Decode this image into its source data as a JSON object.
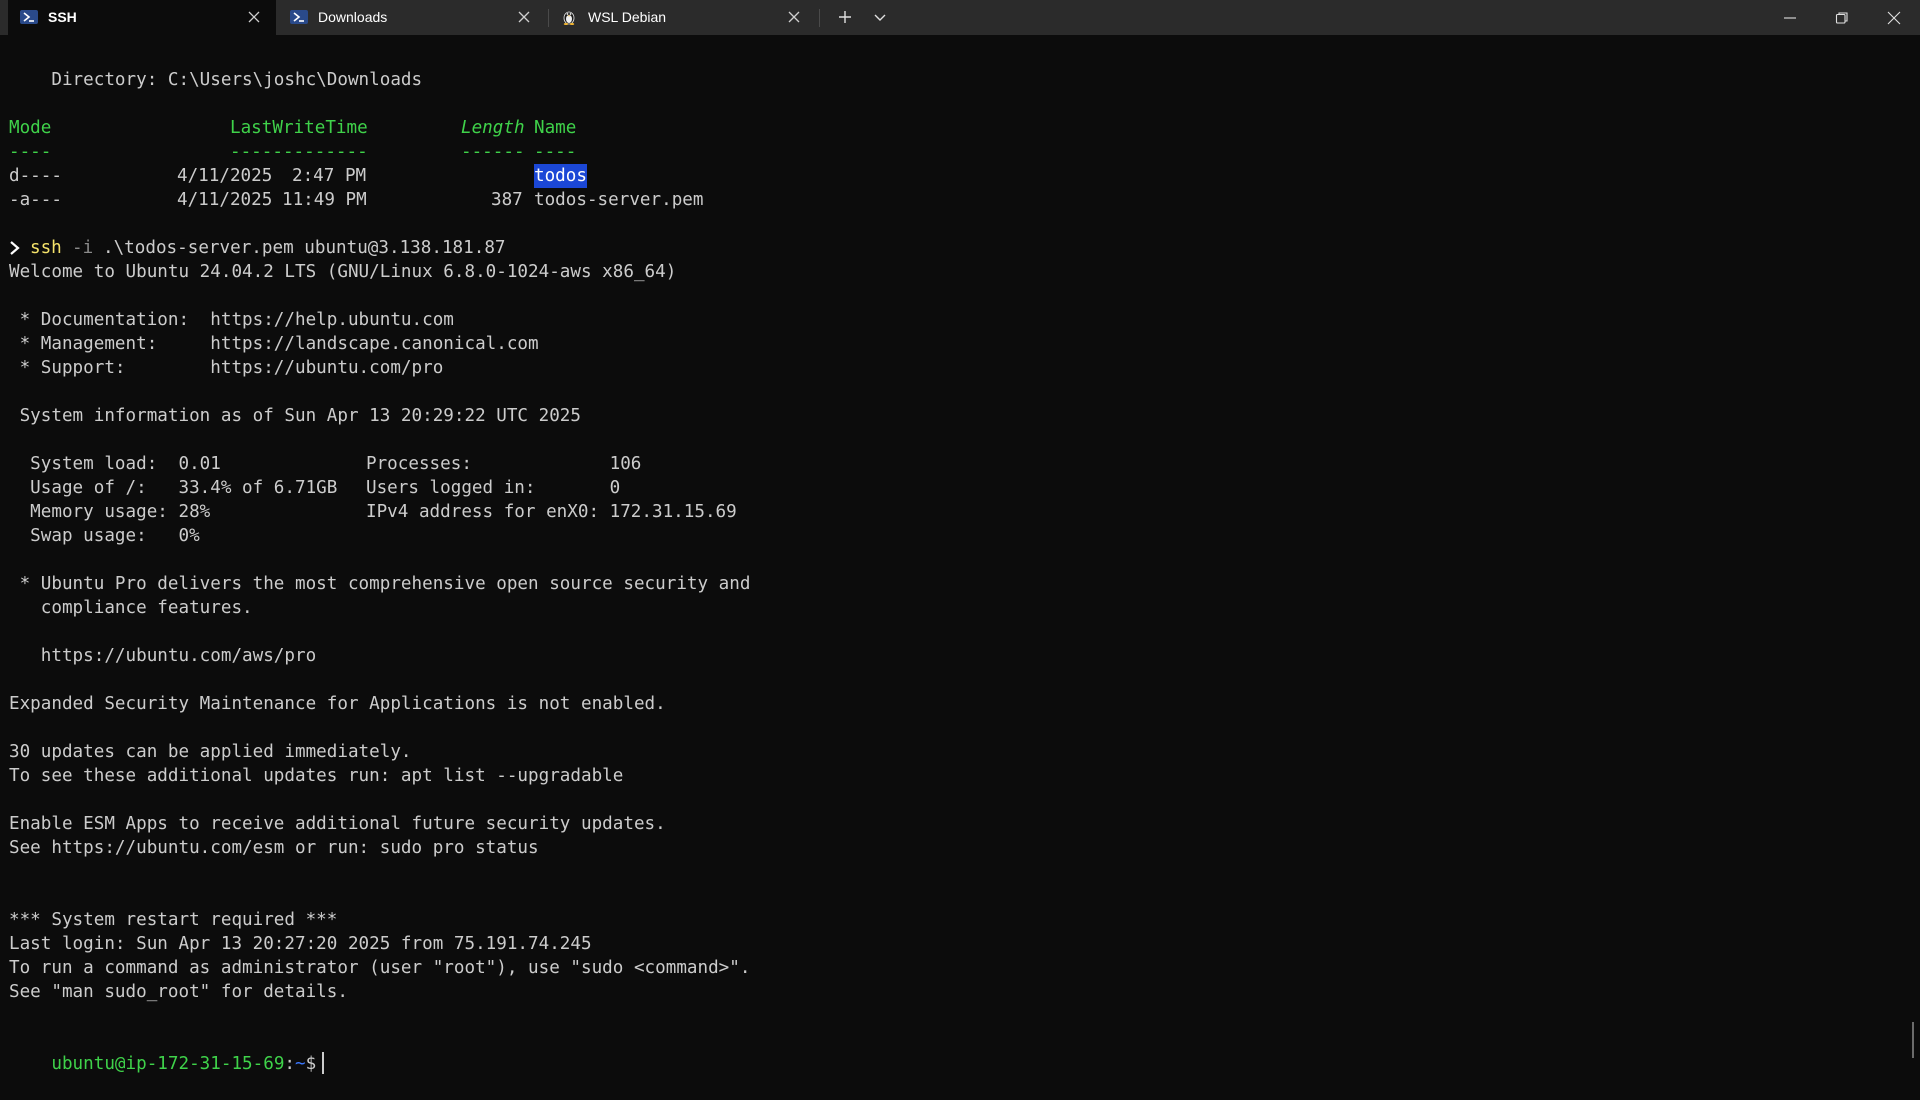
{
  "tabs": [
    {
      "title": "SSH",
      "icon": "powershell-icon",
      "active": true
    },
    {
      "title": "Downloads",
      "icon": "powershell-icon",
      "active": false
    },
    {
      "title": "WSL Debian",
      "icon": "linux-penguin-icon",
      "active": false
    }
  ],
  "toolbar": {
    "new_tab_glyph": "+",
    "dropdown_glyph": "chevron-down-icon"
  },
  "colors": {
    "background": "#0c0c0c",
    "titlebar": "#2b2b2b",
    "text": "#cccccc",
    "green": "#3fd24a",
    "selection": "#1b47d6",
    "command_yellow": "#f5e36b"
  },
  "terminal": {
    "directory_line": "    Directory: C:\\Users\\joshc\\Downloads",
    "headers": {
      "mode": "Mode",
      "lastwrite": "LastWriteTime",
      "length": "Length",
      "name": "Name"
    },
    "underlines": {
      "mode": "----",
      "lastwrite": "-------------",
      "length": "------",
      "name": "----"
    },
    "rows": [
      {
        "mode": "d----",
        "date": "4/11/2025",
        "time": "2:47 PM",
        "length": "",
        "name": "todos"
      },
      {
        "mode": "-a---",
        "date": "4/11/2025",
        "time": "11:49 PM",
        "length": "387",
        "name": "todos-server.pem"
      }
    ],
    "command": {
      "arrow": ">",
      "program": "ssh",
      "flag": "-i",
      "args": ".\\todos-server.pem ubuntu@3.138.181.87"
    },
    "welcome": "Welcome to Ubuntu 24.04.2 LTS (GNU/Linux 6.8.0-1024-aws x86_64)",
    "docs": [
      " * Documentation:  https://help.ubuntu.com",
      " * Management:     https://landscape.canonical.com",
      " * Support:        https://ubuntu.com/pro"
    ],
    "sysinfo_header": " System information as of Sun Apr 13 20:29:22 UTC 2025",
    "sysinfo": [
      {
        "left": "  System load:  0.01",
        "right": "Processes:             106"
      },
      {
        "left": "  Usage of /:   33.4% of 6.71GB",
        "right": "Users logged in:       0"
      },
      {
        "left": "  Memory usage: 28%",
        "right": "IPv4 address for enX0: 172.31.15.69"
      },
      {
        "left": "  Swap usage:   0%",
        "right": ""
      }
    ],
    "pro_lines": [
      " * Ubuntu Pro delivers the most comprehensive open source security and",
      "   compliance features.",
      "",
      "   https://ubuntu.com/aws/pro"
    ],
    "esm_line": "Expanded Security Maintenance for Applications is not enabled.",
    "updates_lines": [
      "30 updates can be applied immediately.",
      "To see these additional updates run: apt list --upgradable"
    ],
    "esm_apps_lines": [
      "Enable ESM Apps to receive additional future security updates.",
      "See https://ubuntu.com/esm or run: sudo pro status"
    ],
    "restart_lines": [
      "*** System restart required ***",
      "Last login: Sun Apr 13 20:27:20 2025 from 75.191.74.245",
      "To run a command as administrator (user \"root\"), use \"sudo <command>\".",
      "See \"man sudo_root\" for details."
    ],
    "prompt": {
      "userhost": "ubuntu@ip-172-31-15-69",
      "colon": ":",
      "path": "~",
      "symbol": "$"
    }
  }
}
